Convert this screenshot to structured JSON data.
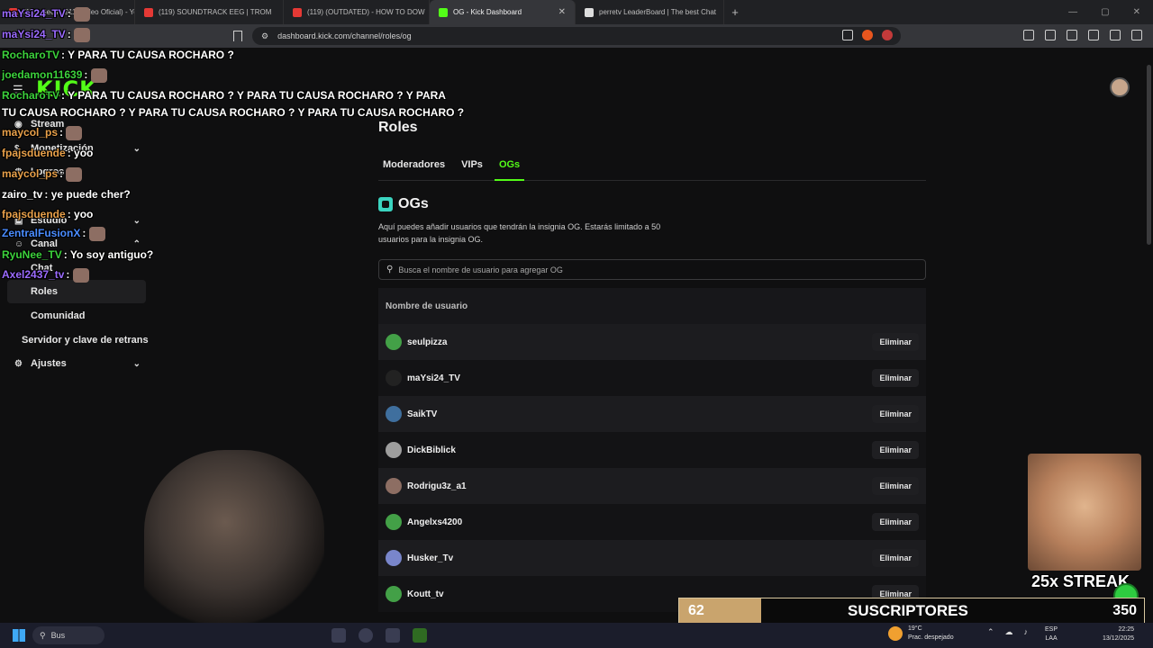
{
  "browser": {
    "tabs": [
      {
        "title": "(119) Sech - 911 (Video Oficial) - You"
      },
      {
        "title": "(119) SOUNDTRACK EEG | TROM"
      },
      {
        "title": "(119) (OUTDATED) - HOW TO DOW"
      },
      {
        "title": "OG - Kick Dashboard",
        "active": true
      },
      {
        "title": "perretv LeaderBoard | The best Chat"
      }
    ],
    "url": "dashboard.kick.com/channel/roles/og"
  },
  "sidebar": {
    "logo": "KICK",
    "items": [
      {
        "label": "Stream",
        "icon": "broadcast-icon"
      },
      {
        "label": "Monetización",
        "icon": "dollar-icon",
        "expandable": true
      },
      {
        "label": "Logros",
        "icon": "trophy-icon"
      },
      {
        "label": "Estudio",
        "icon": "studio-icon",
        "expandable": true
      },
      {
        "label": "Canal",
        "icon": "users-icon",
        "expandable": true
      },
      {
        "label": "Chat"
      },
      {
        "label": "Roles",
        "active": true
      },
      {
        "label": "Comunidad"
      },
      {
        "label": "Servidor y clave de retrans"
      },
      {
        "label": "Ajustes",
        "icon": "gear-icon",
        "expandable": true
      }
    ]
  },
  "main": {
    "title": "Roles",
    "tabs": [
      {
        "label": "Moderadores"
      },
      {
        "label": "VIPs"
      },
      {
        "label": "OGs",
        "active": true
      }
    ],
    "section_title": "OGs",
    "description": "Aquí puedes añadir usuarios que tendrán la insignia OG. Estarás limitado a 50 usuarios para la insignia OG.",
    "search_placeholder": "Busca el nombre de usuario para agregar OG",
    "table_header": "Nombre de usuario",
    "remove_label": "Eliminar",
    "users": [
      "seulpizza",
      "maYsi24_TV",
      "SaikTV",
      "DickBiblick",
      "Rodrigu3z_a1",
      "Angelxs4200",
      "Husker_Tv",
      "Koutt_tv"
    ]
  },
  "chat": [
    {
      "user": "maYsi24_TV",
      "text": ":",
      "color": "#9b6bff"
    },
    {
      "user": "maYsi24_TV",
      "text": ":",
      "color": "#9b6bff"
    },
    {
      "user": "RocharoTV",
      "text": ": Y PARA TU CAUSA ROCHARO ?",
      "color": "#3cd23c"
    },
    {
      "user": "joedamon11639",
      "text": ":",
      "color": "#3cd23c"
    },
    {
      "user": "RocharoTV",
      "text": ": Y PARA TU CAUSA ROCHARO ? Y PARA TU CAUSA ROCHARO ? Y PARA",
      "color": "#3cd23c"
    },
    {
      "user": "",
      "text": "TU CAUSA ROCHARO ? Y PARA TU CAUSA ROCHARO ? Y PARA TU CAUSA ROCHARO ?",
      "color": "#ffffff"
    },
    {
      "user": "maycol_ps",
      "text": ":",
      "color": "#e8a04a"
    },
    {
      "user": "fpajsduende",
      "text": ": yoo",
      "color": "#e8a04a"
    },
    {
      "user": "maycol_ps",
      "text": ":",
      "color": "#e8a04a"
    },
    {
      "user": "zairo_tv",
      "text": ": ye puede cher?",
      "color": "#ffffff"
    },
    {
      "user": "fpajsduende",
      "text": ": yoo",
      "color": "#e8a04a"
    },
    {
      "user": "ZentralFusionX",
      "text": ":",
      "color": "#4a8cff"
    },
    {
      "user": "RyuNee_TV",
      "text": ": Yo soy antiguo?",
      "color": "#3cd23c"
    },
    {
      "user": "Axel2437_tv",
      "text": ":",
      "color": "#9b6bff"
    }
  ],
  "overlay": {
    "streak": "25x STREAK",
    "sub_current": "62",
    "sub_label": "SUSCRIPTORES",
    "sub_goal": "350",
    "sub_progress": 0.177
  },
  "taskbar": {
    "search": "Bus",
    "weather_temp": "19°C",
    "weather_desc": "Prac. despejado",
    "lang_1": "ESP",
    "lang_2": "LAA",
    "time": "22:25",
    "date": "13/12/2025"
  }
}
